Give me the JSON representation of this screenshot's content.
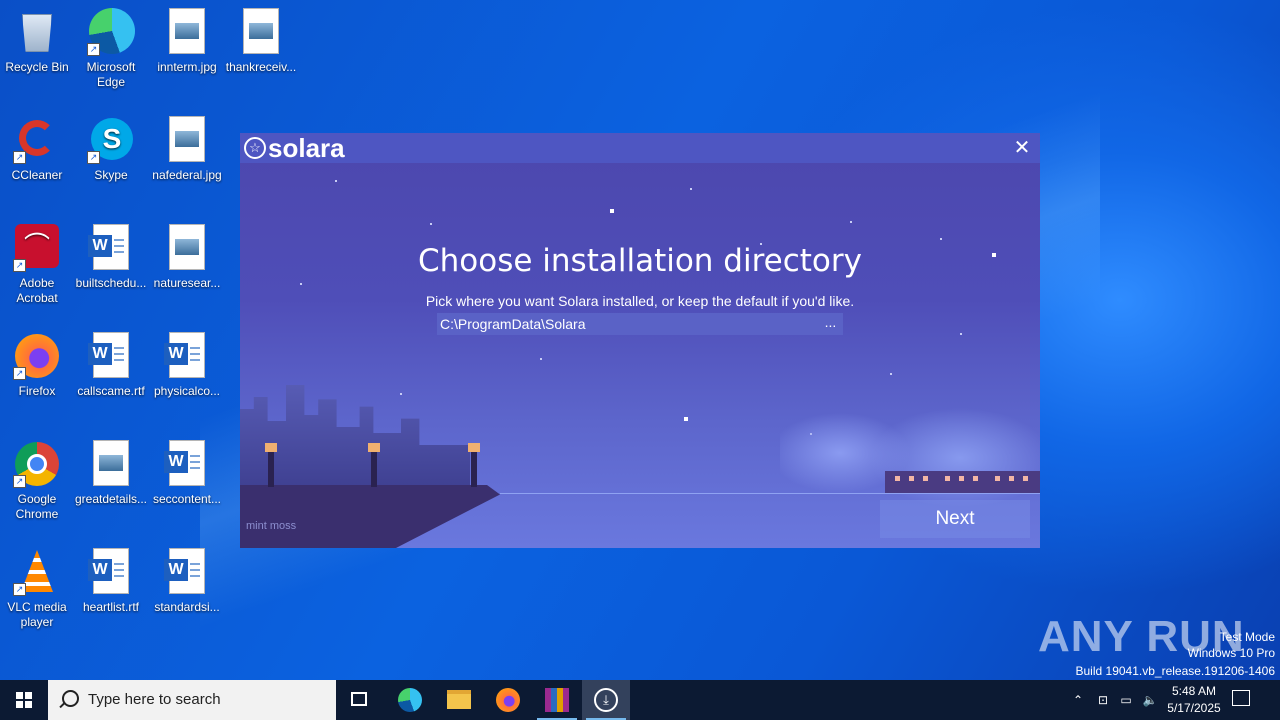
{
  "desktop": {
    "icons": [
      {
        "label": "Recycle Bin"
      },
      {
        "label": "Microsoft Edge"
      },
      {
        "label": "innterm.jpg"
      },
      {
        "label": "thankreceiv..."
      },
      {
        "label": "CCleaner"
      },
      {
        "label": "Skype"
      },
      {
        "label": "nafederal.jpg"
      },
      {
        "label": "Adobe Acrobat"
      },
      {
        "label": "builtschedu..."
      },
      {
        "label": "naturesear..."
      },
      {
        "label": "Firefox"
      },
      {
        "label": "callscame.rtf"
      },
      {
        "label": "physicalco..."
      },
      {
        "label": "Google Chrome"
      },
      {
        "label": "greatdetails..."
      },
      {
        "label": "seccontent..."
      },
      {
        "label": "VLC media player"
      },
      {
        "label": "heartlist.rtf"
      },
      {
        "label": "standardsi..."
      }
    ]
  },
  "installer": {
    "app_name": "solara",
    "heading": "Choose installation directory",
    "subtext": "Pick where you want Solara installed, or keep the default if you'd like.",
    "path_value": "C:\\ProgramData\\Solara",
    "browse_label": "...",
    "next_label": "Next",
    "watermark": "mint moss",
    "close_glyph": "✕",
    "colors": {
      "titlebar": "#4e56c2",
      "background": "#4f4eb8"
    }
  },
  "watermark": {
    "brand": "ANY RUN",
    "test_mode": "Test Mode",
    "edition": "Windows 10 Pro",
    "build": "Build 19041.vb_release.191206-1406"
  },
  "taskbar": {
    "search_placeholder": "Type here to search",
    "pinned": [
      "task-view-icon",
      "edge-icon",
      "file-explorer-icon",
      "firefox-icon",
      "winrar-icon",
      "installer-icon"
    ],
    "time": "5:48 AM",
    "date": "5/17/2025"
  }
}
